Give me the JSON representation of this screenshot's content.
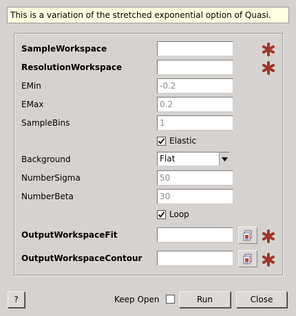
{
  "description": "This is a variation of the stretched exponential option of Quasi.",
  "fields": {
    "sample_workspace": {
      "label": "SampleWorkspace",
      "value": ""
    },
    "resolution_workspace": {
      "label": "ResolutionWorkspace",
      "value": ""
    },
    "emin": {
      "label": "EMin",
      "value": "-0.2"
    },
    "emax": {
      "label": "EMax",
      "value": "0.2"
    },
    "sample_bins": {
      "label": "SampleBins",
      "value": "1"
    },
    "elastic": {
      "label": "Elastic",
      "checked": true
    },
    "background": {
      "label": "Background",
      "value": "Flat"
    },
    "number_sigma": {
      "label": "NumberSigma",
      "value": "50"
    },
    "number_beta": {
      "label": "NumberBeta",
      "value": "30"
    },
    "loop": {
      "label": "Loop",
      "checked": true
    },
    "output_workspace_fit": {
      "label": "OutputWorkspaceFit",
      "value": ""
    },
    "output_workspace_contour": {
      "label": "OutputWorkspaceContour",
      "value": ""
    }
  },
  "footer": {
    "help_label": "?",
    "keep_open_label": "Keep Open",
    "keep_open_checked": false,
    "run_label": "Run",
    "close_label": "Close"
  },
  "colors": {
    "required_star": "#a0362a",
    "description_bg": "#ffffe1",
    "window_bg": "#d6d2d0"
  },
  "icons": {
    "required": "asterisk-icon",
    "browse": "browse-file-icon",
    "dropdown": "chevron-down-icon"
  }
}
